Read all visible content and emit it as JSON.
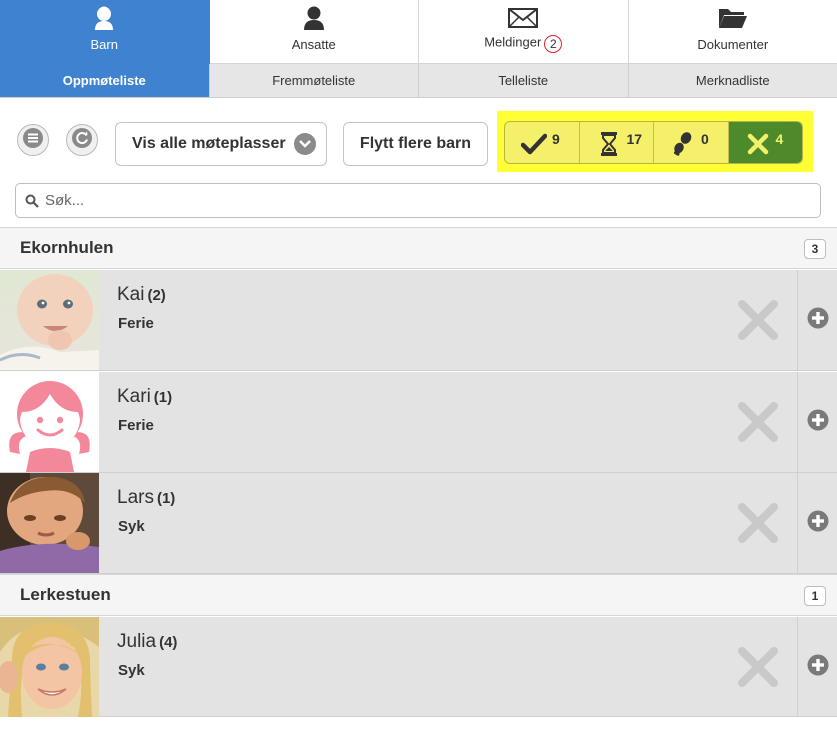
{
  "top_tabs": [
    {
      "label": "Barn",
      "icon": "child-icon",
      "active": true
    },
    {
      "label": "Ansatte",
      "icon": "person-icon",
      "active": false
    },
    {
      "label": "Meldinger",
      "icon": "envelope-icon",
      "badge": "2",
      "active": false
    },
    {
      "label": "Dokumenter",
      "icon": "folder-icon",
      "active": false
    }
  ],
  "sub_tabs": [
    {
      "label": "Oppmøteliste",
      "active": true
    },
    {
      "label": "Fremmøteliste",
      "active": false
    },
    {
      "label": "Telleliste",
      "active": false
    },
    {
      "label": "Merknadliste",
      "active": false
    }
  ],
  "toolbar": {
    "menu_icon": "hamburger-icon",
    "refresh_icon": "refresh-icon",
    "location_select": "Vis alle møteplasser",
    "move_button": "Flytt flere barn"
  },
  "status_counts": {
    "present": "9",
    "waiting": "17",
    "picked_up": "0",
    "absent": "4",
    "active_filter": "absent",
    "highlight_color": "#ffff33",
    "active_color": "#4d8a2c"
  },
  "search": {
    "placeholder": "Søk..."
  },
  "groups": [
    {
      "title": "Ekornhulen",
      "count": "3",
      "children": [
        {
          "name": "Kai",
          "count": "(2)",
          "status": "Ferie"
        },
        {
          "name": "Kari",
          "count": "(1)",
          "status": "Ferie"
        },
        {
          "name": "Lars",
          "count": "(1)",
          "status": "Syk"
        }
      ]
    },
    {
      "title": "Lerkestuen",
      "count": "1",
      "children": [
        {
          "name": "Julia",
          "count": "(4)",
          "status": "Syk"
        }
      ]
    }
  ],
  "colors": {
    "primary": "#3f82d0",
    "badge_border": "#d9262c",
    "row_background": "#e3e3e3"
  }
}
